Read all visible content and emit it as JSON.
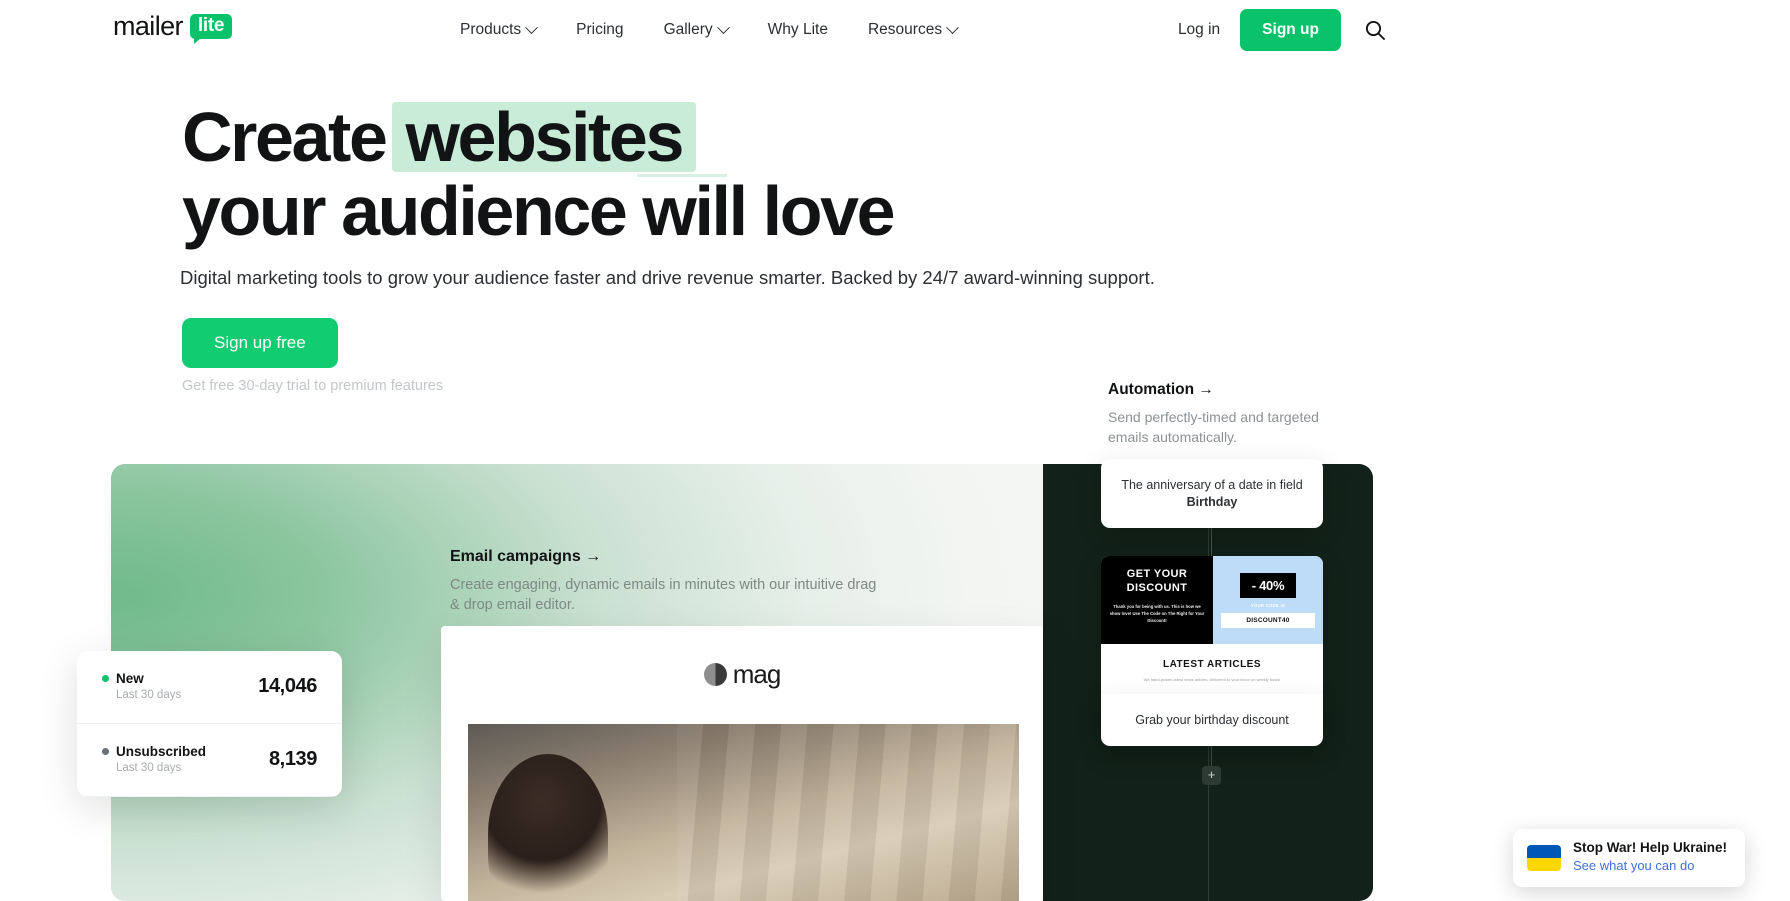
{
  "brand": {
    "accent_green": "#09c269",
    "cta_green": "#11cc71",
    "highlight_green": "#c9ecd8",
    "dark_panel": "#122119",
    "logo_word": "mailer",
    "logo_badge": "lite"
  },
  "nav": {
    "items": [
      {
        "label": "Products",
        "has_caret": true
      },
      {
        "label": "Pricing",
        "has_caret": false
      },
      {
        "label": "Gallery",
        "has_caret": true
      },
      {
        "label": "Why Lite",
        "has_caret": false
      },
      {
        "label": "Resources",
        "has_caret": true
      }
    ],
    "login_label": "Log in",
    "signup_label": "Sign up",
    "search_icon": "search-icon"
  },
  "hero": {
    "title_part1": "Create",
    "title_highlight": "websites",
    "title_line2": "your audience will love",
    "subtitle": "Digital marketing tools to grow your audience faster and drive revenue smarter. Backed by 24/7 award-winning support.",
    "cta_label": "Sign up free",
    "trial_note": "Get free 30-day trial to premium features"
  },
  "automation_blurb": {
    "title": "Automation →",
    "text": "Send perfectly-timed and targeted emails automatically."
  },
  "email_blurb": {
    "title": "Email campaigns →",
    "text": "Create engaging, dynamic emails in minutes with our intuitive drag & drop email editor."
  },
  "mag_preview": {
    "logo_text": "mag"
  },
  "stats": {
    "rows": [
      {
        "name": "New",
        "sub": "Last 30 days",
        "value": "14,046",
        "dot_color": "#09c269"
      },
      {
        "name": "Unsubscribed",
        "sub": "Last 30 days",
        "value": "8,139",
        "dot_color": "#6b7076"
      }
    ]
  },
  "automation_flow": {
    "trigger_prefix": "The anniversary of a date in field ",
    "trigger_field": "Birthday",
    "email": {
      "headline_line1": "GET YOUR",
      "headline_line2": "DISCOUNT",
      "body": "Thank you for being with us. This is how we show love! Use The Code on The Right for Your Discount!",
      "discount": "- 40%",
      "code_label": "YOUR CODE IS",
      "code": "DISCOUNT40",
      "articles_title": "LATEST ARTICLES",
      "articles_body": "We hand-picked latest news articles, delivered to your inbox on weekly basis!"
    },
    "action_label": "Grab your birthday discount",
    "add_step_label": "+"
  },
  "ukraine_banner": {
    "title": "Stop War! Help Ukraine!",
    "link": "See what you can do"
  }
}
